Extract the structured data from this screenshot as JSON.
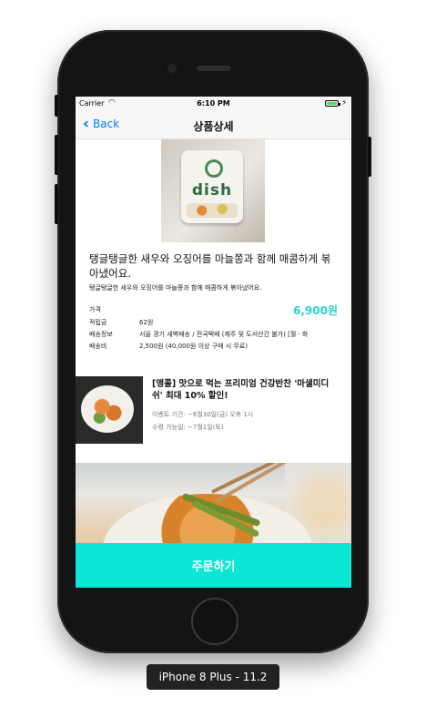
{
  "status_bar": {
    "carrier": "Carrier",
    "time": "6:10 PM",
    "wifi_icon": "wifi-icon",
    "battery_icon": "battery-icon",
    "battery_level": 1.0
  },
  "nav": {
    "back_label": "Back",
    "title": "상품상세"
  },
  "product": {
    "image_text": "dish",
    "title": "탱글탱글한 새우와 오징어를 마늘쫑과 함께 매콤하게 볶아냈어요.",
    "subtitle": "탱글탱글한 새우와 오징어를 마늘쫑과 함께 매콤하게 볶아냈어요.",
    "price": "6,900원",
    "info": [
      {
        "label": "가격",
        "value": ""
      },
      {
        "label": "적립금",
        "value": "62원"
      },
      {
        "label": "배송정보",
        "value": "서울 경기 새벽배송 / 전국택배 (제주 및 도서산간 불가) [월 · 화"
      },
      {
        "label": "배송비",
        "value": "2,500원 (40,000원 이상 구매 시 무료)"
      }
    ]
  },
  "event": {
    "title": "[앵콜] 맛으로 먹는 프리미엄 건강반찬 '마샐미디쉬' 최대 10% 할인!",
    "period": "이벤트 기간: ~6월30일(금) 오후 1시",
    "delivery": "수령 가능일: ~7월1일(토)"
  },
  "order_button": "주문하기",
  "device_label": "iPhone 8 Plus - 11.2"
}
